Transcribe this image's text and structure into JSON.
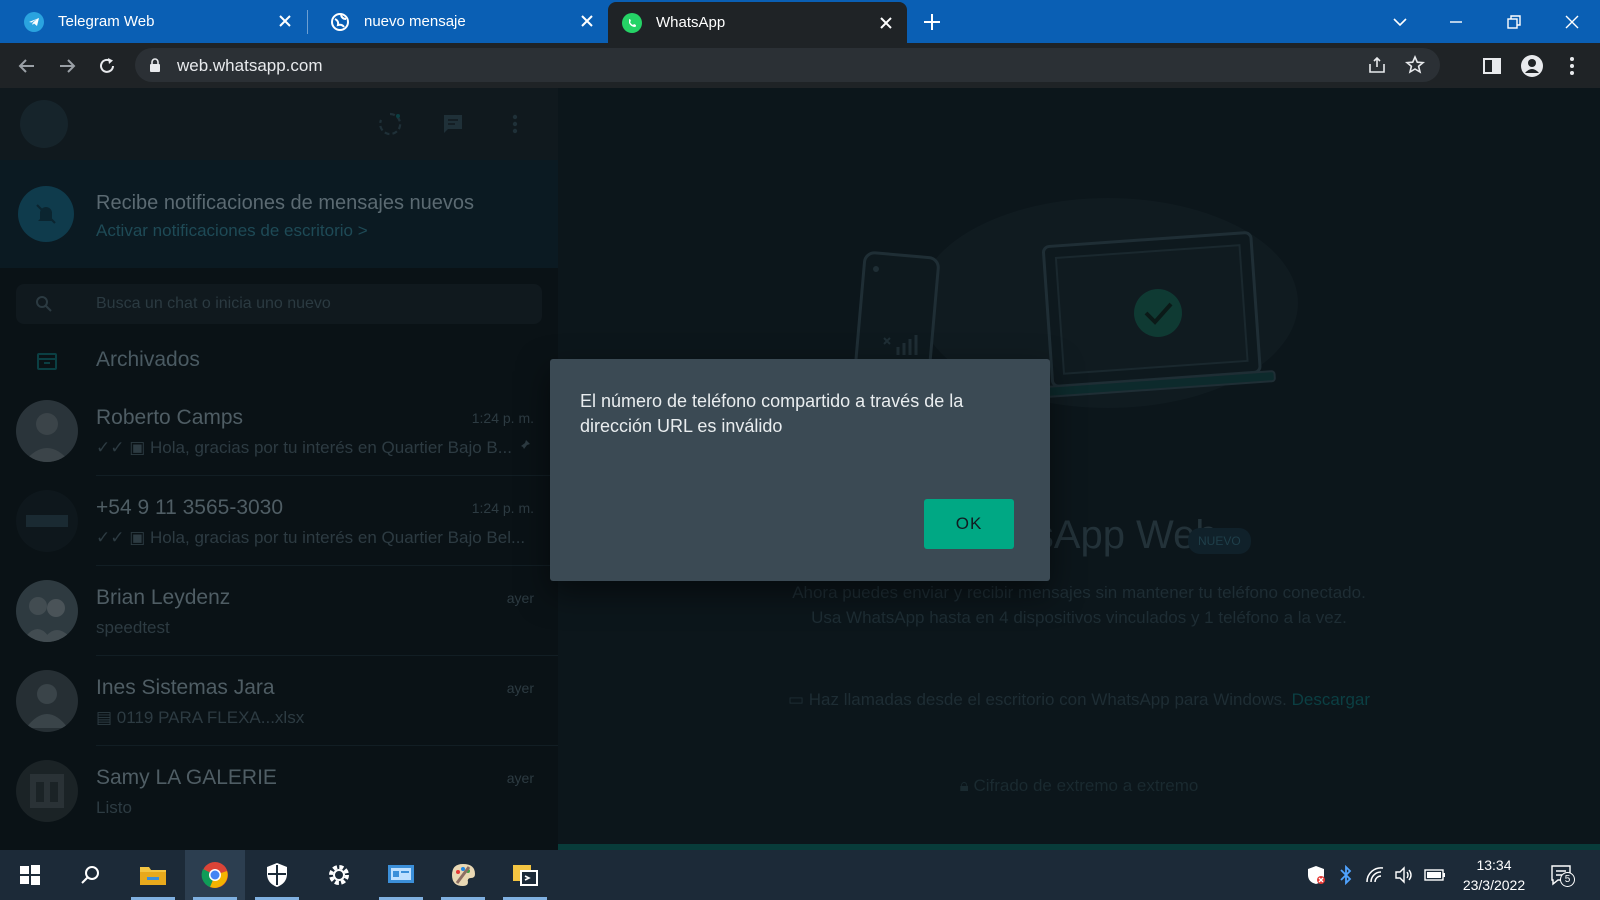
{
  "browser": {
    "tabs": [
      {
        "title": "Telegram Web",
        "icon": "telegram-icon"
      },
      {
        "title": "nuevo mensaje",
        "icon": "globe-icon"
      },
      {
        "title": "WhatsApp",
        "icon": "whatsapp-icon",
        "active": true
      }
    ],
    "url": "web.whatsapp.com"
  },
  "sidebar": {
    "notification": {
      "title": "Recibe notificaciones de mensajes nuevos",
      "subtitle": "Activar notificaciones de escritorio >"
    },
    "search_placeholder": "Busca un chat o inicia uno nuevo",
    "archived_label": "Archivados",
    "chats": [
      {
        "name": "Roberto Camps",
        "time": "1:24 p. m.",
        "message": "Hola, gracias por tu interés en Quartier Bajo B..."
      },
      {
        "name": "+54 9 11 3565-3030",
        "time": "1:24 p. m.",
        "message": "Hola, gracias por tu interés en Quartier Bajo Bel..."
      },
      {
        "name": "Brian Leydenz",
        "time": "ayer",
        "message": "speedtest"
      },
      {
        "name": "Ines Sistemas Jara",
        "time": "ayer",
        "message": "0119 PARA FLEXA...xlsx"
      },
      {
        "name": "Samy LA GALERIE",
        "time": "ayer",
        "message": "Listo"
      }
    ]
  },
  "main": {
    "title": "WhatsApp Web",
    "badge": "NUEVO",
    "line1": "Ahora puedes enviar y recibir mensajes sin mantener tu teléfono conectado.",
    "line2": "Usa WhatsApp hasta en 4 dispositivos vinculados y 1 teléfono a la vez.",
    "calls_text": "Haz llamadas desde el escritorio con WhatsApp para Windows.",
    "calls_link": "Descargar",
    "e2e": "Cifrado de extremo a extremo"
  },
  "dialog": {
    "message": "El número de teléfono compartido a través de la dirección URL es inválido",
    "ok_label": "OK"
  },
  "taskbar": {
    "time": "13:34",
    "date": "23/3/2022",
    "notifications_count": "5"
  },
  "colors": {
    "accent": "#00a884",
    "tabstrip": "#0a5fb4",
    "dialog_bg": "#3b4a54"
  }
}
